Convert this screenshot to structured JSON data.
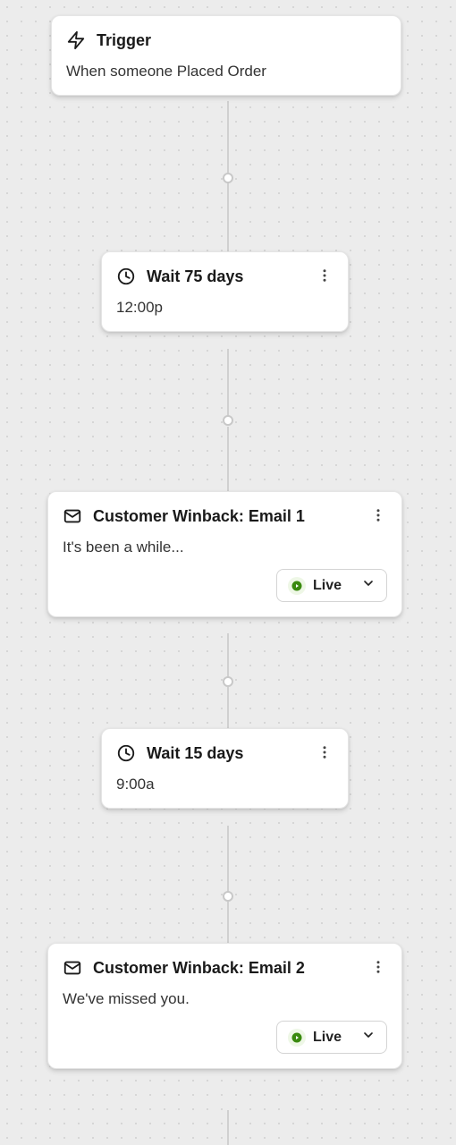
{
  "nodes": {
    "trigger": {
      "title": "Trigger",
      "description": "When someone Placed Order"
    },
    "wait1": {
      "title": "Wait 75 days",
      "time": "12:00p"
    },
    "email1": {
      "title": "Customer Winback: Email 1",
      "subject": "It's been a while...",
      "status": "Live"
    },
    "wait2": {
      "title": "Wait 15 days",
      "time": "9:00a"
    },
    "email2": {
      "title": "Customer Winback: Email 2",
      "subject": "We've missed you.",
      "status": "Live"
    }
  }
}
